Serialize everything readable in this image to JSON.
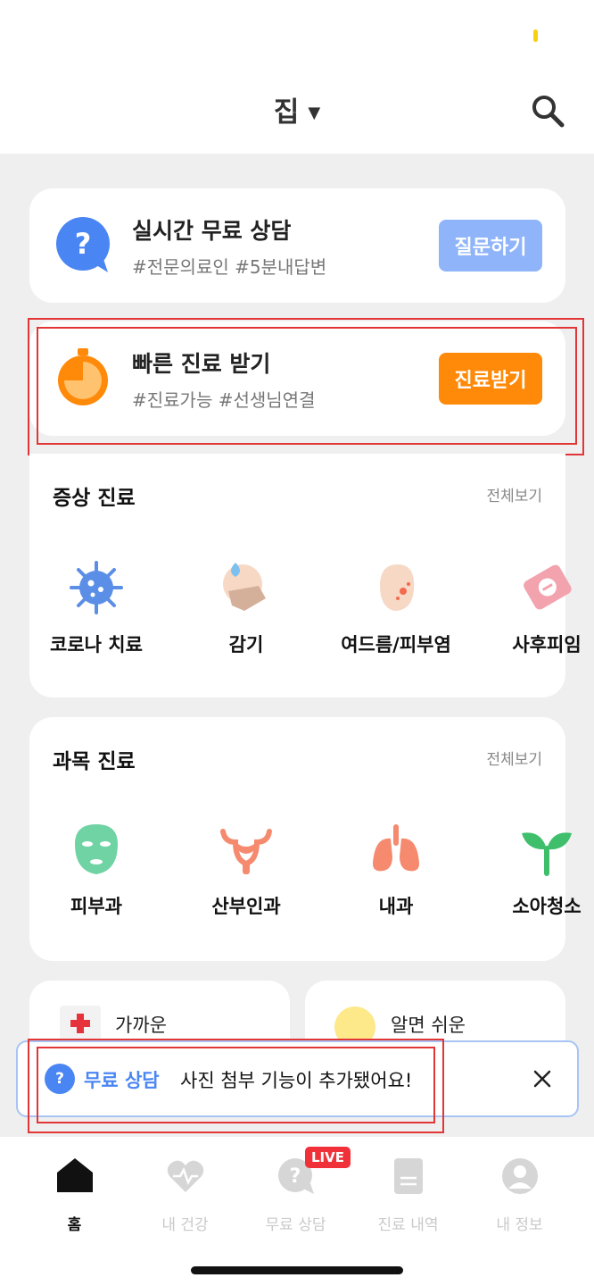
{
  "header": {
    "location": "집",
    "caret": "▼"
  },
  "services": {
    "free_consult": {
      "title": "실시간 무료 상담",
      "tags": "#전문의료인 #5분내답변",
      "button": "질문하기"
    },
    "quick_care": {
      "title": "빠른 진료 받기",
      "tags": "#진료가능 #선생님연결",
      "button": "진료받기"
    }
  },
  "symptom_section": {
    "title": "증상 진료",
    "more": "전체보기",
    "items": [
      {
        "label": "코로나 치료",
        "icon": "virus-icon"
      },
      {
        "label": "감기",
        "icon": "cold-mask-icon"
      },
      {
        "label": "여드름/피부염",
        "icon": "acne-face-icon"
      },
      {
        "label": "사후피임",
        "icon": "pill-pack-icon"
      }
    ]
  },
  "department_section": {
    "title": "과목 진료",
    "more": "전체보기",
    "items": [
      {
        "label": "피부과",
        "icon": "face-mask-icon"
      },
      {
        "label": "산부인과",
        "icon": "uterus-icon"
      },
      {
        "label": "내과",
        "icon": "lungs-icon"
      },
      {
        "label": "소아청소",
        "icon": "sprout-icon"
      }
    ]
  },
  "mini_cards": [
    {
      "label": "가까운",
      "icon": "red-cross-icon"
    },
    {
      "label": "알면 쉬운",
      "icon": "yellow-emoji-icon"
    }
  ],
  "banner": {
    "tag": "무료 상담",
    "message": "사진 첨부 기능이 추가됐어요!"
  },
  "bottom_nav": {
    "items": [
      {
        "label": "홈",
        "icon": "home-icon",
        "active": true
      },
      {
        "label": "내 건강",
        "icon": "heart-pulse-icon",
        "active": false
      },
      {
        "label": "무료 상담",
        "icon": "question-bubble-icon",
        "active": false
      },
      {
        "label": "진료 내역",
        "icon": "document-icon",
        "active": false
      },
      {
        "label": "내 정보",
        "icon": "profile-icon",
        "active": false
      }
    ],
    "live_badge": "LIVE"
  },
  "colors": {
    "accent_blue": "#8fb4f9",
    "accent_orange": "#ff8a0a",
    "highlight_red": "#e23636",
    "brand_blue": "#4a86f3"
  }
}
